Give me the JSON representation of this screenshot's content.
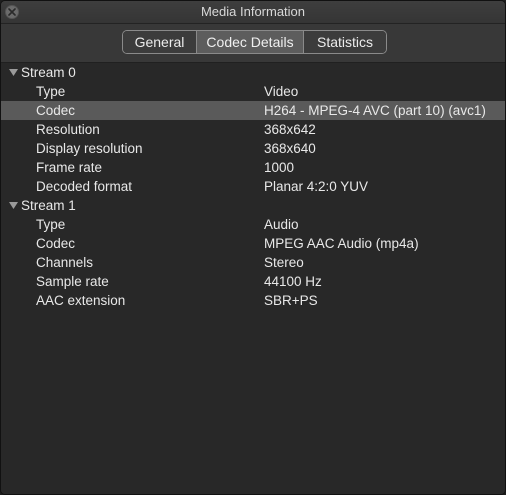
{
  "window": {
    "title": "Media Information"
  },
  "tabs": [
    {
      "label": "General",
      "selected": false
    },
    {
      "label": "Codec Details",
      "selected": true
    },
    {
      "label": "Statistics",
      "selected": false
    }
  ],
  "streams": [
    {
      "label": "Stream 0",
      "expanded": true,
      "properties": [
        {
          "key": "Type",
          "value": "Video"
        },
        {
          "key": "Codec",
          "value": "H264 - MPEG-4 AVC (part 10) (avc1)"
        },
        {
          "key": "Resolution",
          "value": "368x642"
        },
        {
          "key": "Display resolution",
          "value": "368x640"
        },
        {
          "key": "Frame rate",
          "value": "1000"
        },
        {
          "key": "Decoded format",
          "value": "Planar 4:2:0 YUV"
        }
      ]
    },
    {
      "label": "Stream 1",
      "expanded": true,
      "properties": [
        {
          "key": "Type",
          "value": "Audio"
        },
        {
          "key": "Codec",
          "value": "MPEG AAC Audio (mp4a)"
        },
        {
          "key": "Channels",
          "value": "Stereo"
        },
        {
          "key": "Sample rate",
          "value": "44100 Hz"
        },
        {
          "key": "AAC extension",
          "value": "SBR+PS"
        }
      ]
    }
  ],
  "colors": {
    "window_bg": "#282828",
    "selected_row": "#5a5a5a",
    "text": "#e8e8e8"
  }
}
